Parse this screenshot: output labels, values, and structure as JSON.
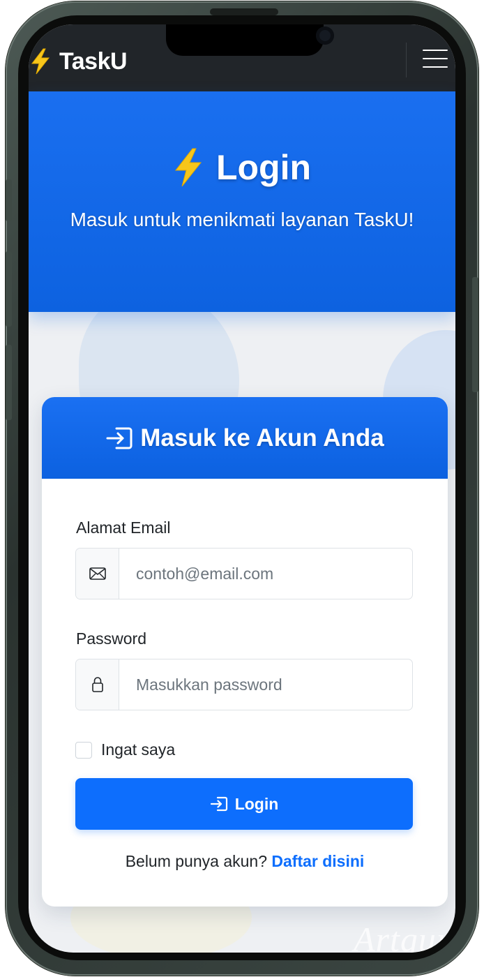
{
  "navbar": {
    "brand_name": "TaskU",
    "brand_icon": "lightning-bolt-icon",
    "menu_icon": "hamburger-menu-icon"
  },
  "hero": {
    "title": "Login",
    "title_icon": "lightning-bolt-icon",
    "subtitle": "Masuk untuk menikmati layanan TaskU!"
  },
  "login_card": {
    "header_title": "Masuk ke Akun Anda",
    "header_icon": "sign-in-icon",
    "email": {
      "label": "Alamat Email",
      "placeholder": "contoh@email.com",
      "value": "",
      "icon": "envelope-icon"
    },
    "password": {
      "label": "Password",
      "placeholder": "Masukkan password",
      "value": "",
      "icon": "lock-icon"
    },
    "remember_me": {
      "label": "Ingat saya",
      "checked": false
    },
    "submit": {
      "label": "Login",
      "icon": "sign-in-icon"
    },
    "register": {
      "prompt": "Belum punya akun?",
      "link_text": "Daftar disini"
    }
  },
  "watermark": "Artguru",
  "colors": {
    "primary": "#0d6efd",
    "navbar": "#212529",
    "bolt": "#f7c61b",
    "text": "#212529",
    "muted": "#6c757d"
  }
}
